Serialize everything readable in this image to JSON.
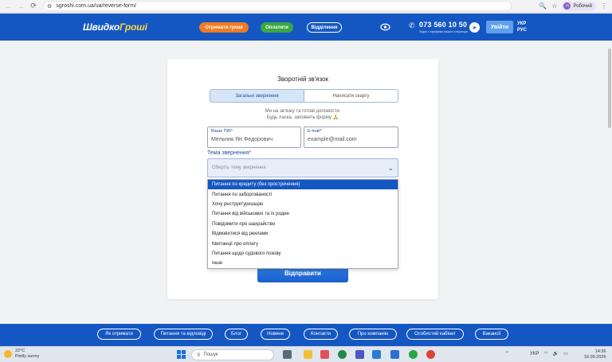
{
  "browser": {
    "url": "sgroshi.com.ua/ua/reverse-form/",
    "profile_initial": "Н",
    "profile_name": "Робочий"
  },
  "header": {
    "logo_part1": "Швидко",
    "logo_part2": "Гроші",
    "btn_get_money": "Отримати гроші",
    "btn_pay": "Оплатити",
    "btn_branches": "Відділення",
    "phone": "073 560 10 50",
    "phone_sub": "Згідно з тарифами вашого оператора",
    "login": "Увійти",
    "lang_ukr": "УКР",
    "lang_rus": "РУС"
  },
  "form": {
    "title": "Зворотній зв'язок",
    "tab_general": "Загальні звернення",
    "tab_complaint": "Написати скаргу",
    "hint_line1": "Ми на зв'язку та готові допомогти.",
    "hint_line2": "Будь ласка, заповніть форму 🙏",
    "name_label": "Ваше ПІБ*",
    "name_value": "Мельник Ян Федорович",
    "email_label": "E-mail*",
    "email_placeholder": "example@mail.com",
    "topic_label": "Тема звернення*",
    "topic_placeholder": "Оберіть тему звернення",
    "submit": "Відправити"
  },
  "dropdown": {
    "options": [
      "Питання по кредиту (без прострочення)",
      "Питання по заборгованості",
      "Хочу реструктуризацію",
      "Питання від військових та їх родин",
      "Повідомити про шахрайство",
      "Відмовитися від реклами",
      "Квитанції про оплату",
      "Питання щодо судового позову",
      "Інше"
    ],
    "selected_index": 0
  },
  "footer": {
    "links": [
      "Як отримати",
      "Питання та відповіді",
      "Блог",
      "Новини",
      "Контакти",
      "Про компанію",
      "Особистий кабінет",
      "Вакансії"
    ]
  },
  "taskbar": {
    "temperature": "22°C",
    "weather": "Partly sunny",
    "search_placeholder": "Пошук",
    "lang": "УКР",
    "time": "14:36",
    "date": "16.09.2026"
  },
  "colors": {
    "brand_blue": "#1557c2",
    "orange": "#f07b22",
    "green": "#3aa845"
  }
}
